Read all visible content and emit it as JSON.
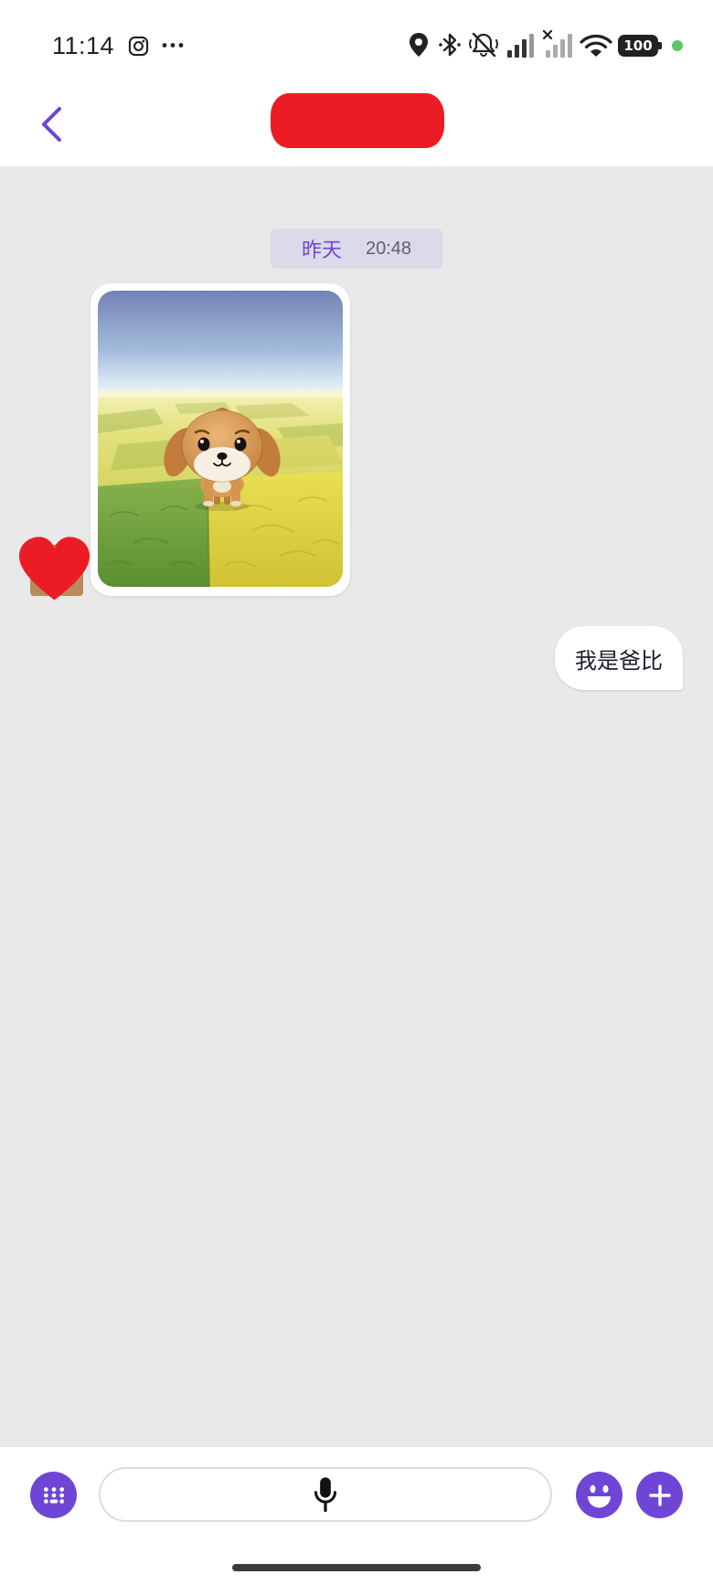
{
  "status_bar": {
    "time": "11:14",
    "battery": "100",
    "left_icons": [
      "instagram-icon",
      "more-dots-icon"
    ],
    "right_icons": [
      "location-icon",
      "bluetooth-icon",
      "bell-muted-icon",
      "signal-icon",
      "signal-no-service-icon",
      "wifi-icon",
      "battery-icon"
    ]
  },
  "header": {
    "back_icon": "chevron-left-icon"
  },
  "chat": {
    "timestamp": {
      "day": "昨天",
      "time": "20:48"
    },
    "messages": [
      {
        "from_me": false,
        "image": true
      },
      {
        "from_me": true,
        "text": "我是爸比"
      }
    ]
  },
  "input_bar": {
    "left_icon": "keyboard-icon",
    "center_icon": "microphone-icon",
    "right_icons": [
      "emoji-icon",
      "plus-icon"
    ]
  },
  "colors": {
    "accent": "#6f45d6",
    "chat_background": "#e9e9e9",
    "timestamp_pill": "#dcd9e8",
    "redaction": "#ec1c24",
    "online_dot": "#5ec46c"
  }
}
